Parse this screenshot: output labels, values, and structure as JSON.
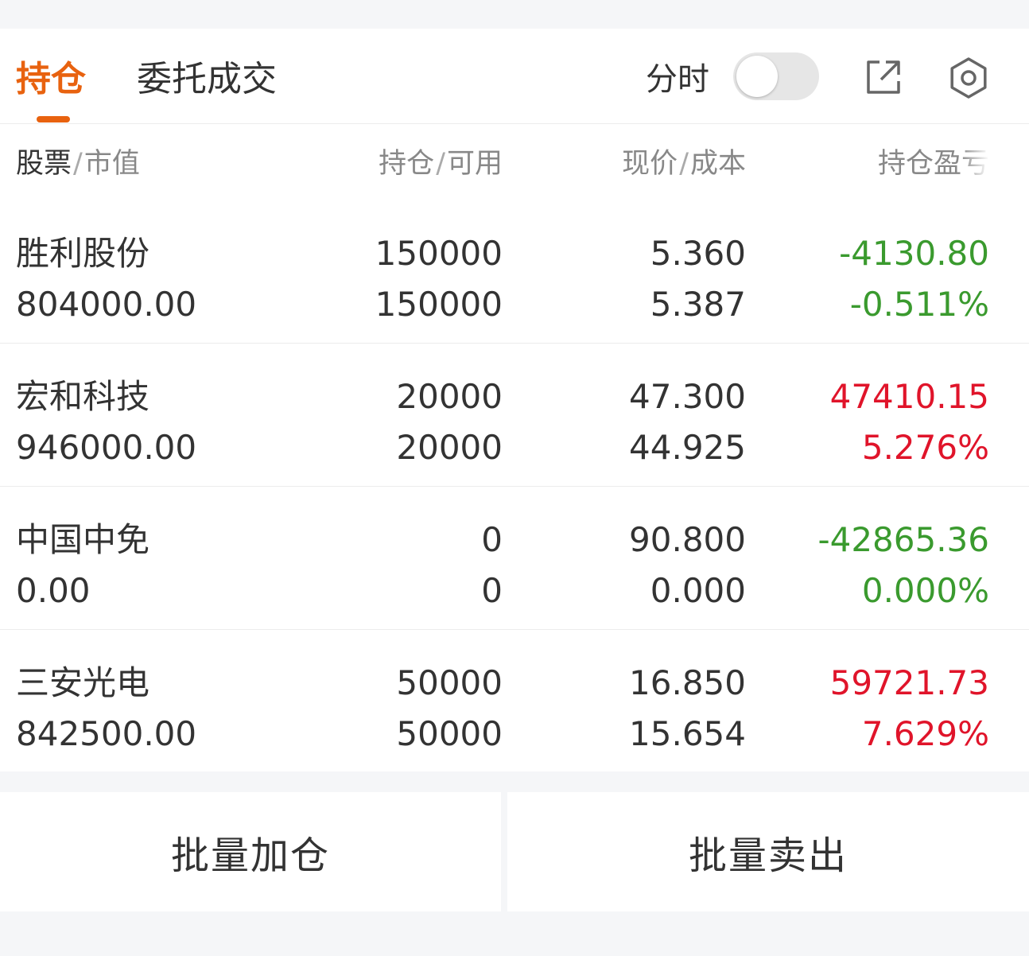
{
  "tabs": [
    {
      "label": "持仓",
      "active": true
    },
    {
      "label": "委托成交",
      "active": false
    }
  ],
  "toolbar": {
    "fenshi_label": "分时",
    "fenshi_toggle_on": false,
    "export_icon": "external-link-icon",
    "settings_icon": "gear-icon"
  },
  "table": {
    "headers": {
      "stock": "股票",
      "market_value": "市值",
      "position": "持仓",
      "available": "可用",
      "price": "现价",
      "cost": "成本",
      "pl": "持仓盈亏"
    },
    "rows": [
      {
        "name": "胜利股份",
        "market_value": "804000.00",
        "position": "150000",
        "available": "150000",
        "price": "5.360",
        "cost": "5.387",
        "pl": "-4130.80",
        "pl_pct": "-0.511%",
        "pl_color": "#3a9a2e"
      },
      {
        "name": "宏和科技",
        "market_value": "946000.00",
        "position": "20000",
        "available": "20000",
        "price": "47.300",
        "cost": "44.925",
        "pl": "47410.15",
        "pl_pct": "5.276%",
        "pl_color": "#e0142a"
      },
      {
        "name": "中国中免",
        "market_value": "0.00",
        "position": "0",
        "available": "0",
        "price": "90.800",
        "cost": "0.000",
        "pl": "-42865.36",
        "pl_pct": "0.000%",
        "pl_color": "#3a9a2e"
      },
      {
        "name": "三安光电",
        "market_value": "842500.00",
        "position": "50000",
        "available": "50000",
        "price": "16.850",
        "cost": "15.654",
        "pl": "59721.73",
        "pl_pct": "7.629%",
        "pl_color": "#e0142a"
      }
    ]
  },
  "actions": {
    "batch_add": "批量加仓",
    "batch_sell": "批量卖出"
  },
  "colors": {
    "accent": "#e8620f",
    "loss": "#3a9a2e",
    "gain": "#e0142a"
  }
}
